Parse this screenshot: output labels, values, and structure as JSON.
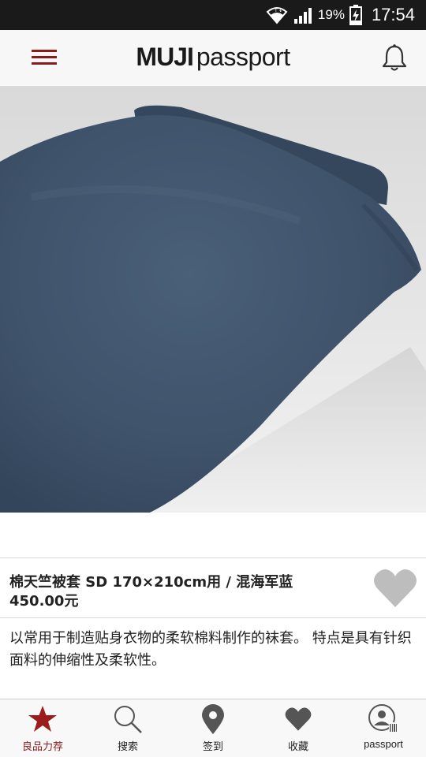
{
  "status_bar": {
    "battery_percent": "19%",
    "time": "17:54",
    "icons": [
      "wifi-icon",
      "signal-icon",
      "battery-charging-icon"
    ]
  },
  "header": {
    "logo_brand": "MUJI",
    "logo_product": "passport",
    "icons": [
      "menu-icon",
      "bell-icon"
    ],
    "accent_color": "#8b1a1a"
  },
  "hero": {
    "image_subject": "navy duvet cover on bed",
    "duvet_color": "#3f536b"
  },
  "product": {
    "name": "棉天竺被套 SD 170×210cm用 / 混海军蓝",
    "price": "450.00元",
    "favorite_icon": "heart-icon",
    "favorite_color": "#bdbdbd"
  },
  "description": {
    "text": "以常用于制造贴身衣物的柔软棉料制作的袜套。 特点是具有针织面料的伸缩性及柔软性。"
  },
  "bottom_nav": {
    "items": [
      {
        "label": "良品力荐",
        "icon": "star-icon",
        "active": true
      },
      {
        "label": "搜索",
        "icon": "search-icon",
        "active": false
      },
      {
        "label": "签到",
        "icon": "location-pin-icon",
        "active": false
      },
      {
        "label": "收藏",
        "icon": "heart-icon",
        "active": false
      },
      {
        "label": "passport",
        "icon": "passport-user-icon",
        "active": false
      }
    ]
  }
}
